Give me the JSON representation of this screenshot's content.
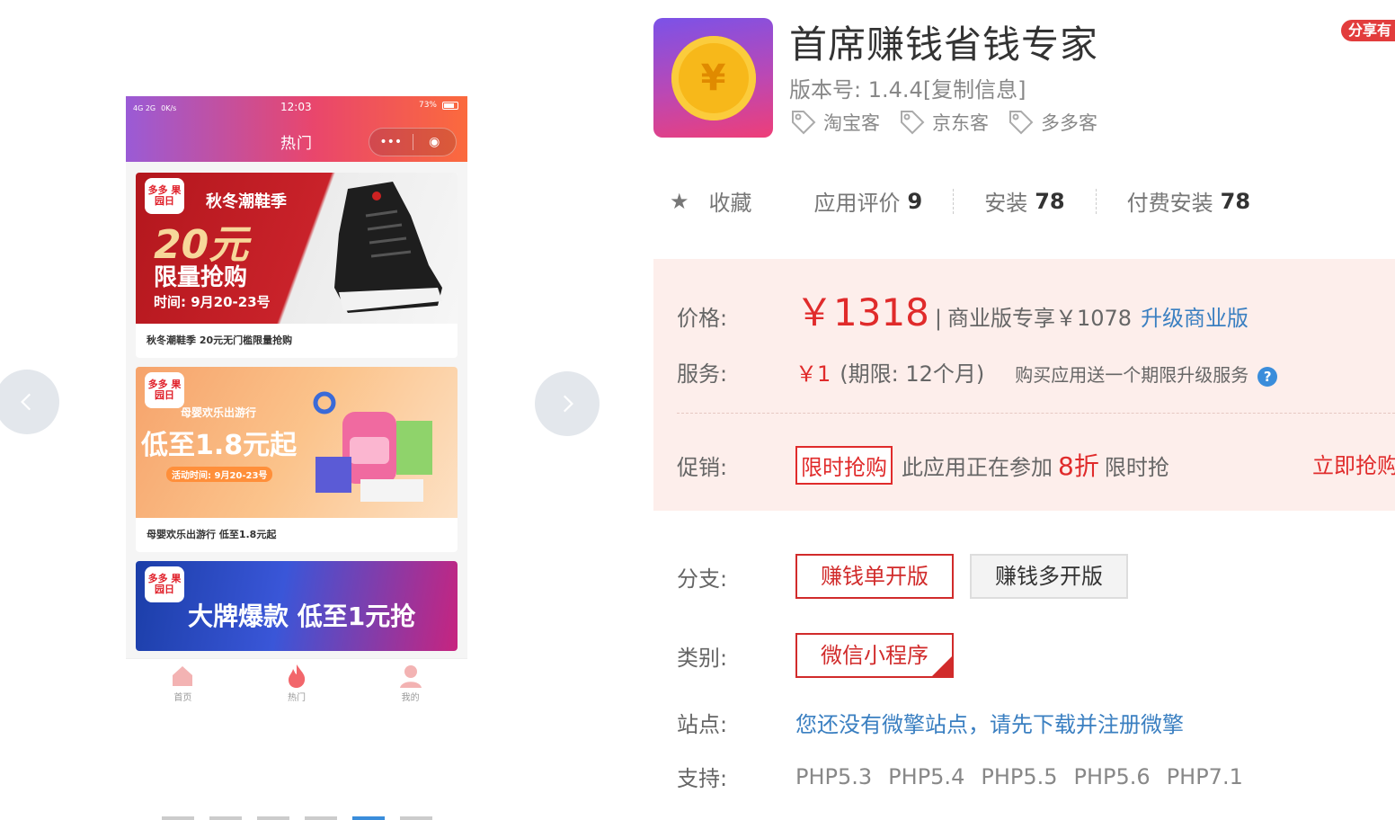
{
  "carousel": {
    "prev_icon": "chevron-left-icon",
    "next_icon": "chevron-right-icon"
  },
  "phone": {
    "status": {
      "signal": "4G 2G",
      "speed": "0K/s",
      "time": "12:03",
      "battery": "73%"
    },
    "title": "热门",
    "capsule_more": "•••",
    "capsule_close": "◉",
    "cards": [
      {
        "logo": "多多 果园日",
        "sub": "秋冬潮鞋季",
        "big": "20元",
        "mid": "限量抢购",
        "time": "时间: 9月20-23号",
        "caption": "秋冬潮鞋季 20元无门槛限量抢购"
      },
      {
        "logo": "多多 果园日",
        "sub": "母婴欢乐出游行",
        "big": "低至1.8元起",
        "time": "活动时间: 9月20-23号",
        "caption": "母婴欢乐出游行 低至1.8元起"
      },
      {
        "logo": "多多 果园日",
        "big": "大牌爆款 低至1元抢"
      }
    ],
    "tabs": [
      {
        "label": "首页",
        "icon": "home-icon"
      },
      {
        "label": "热门",
        "icon": "flame-icon"
      },
      {
        "label": "我的",
        "icon": "user-icon"
      }
    ]
  },
  "app": {
    "title": "首席赚钱省钱专家",
    "share_label": "分享有",
    "version_label": "版本号:",
    "version": "1.4.4",
    "copy_info": "[复制信息]",
    "tags": [
      "淘宝客",
      "京东客",
      "多多客"
    ]
  },
  "stats": {
    "favorite": "收藏",
    "rating_label": "应用评价",
    "rating": "9",
    "install_label": "安装",
    "install": "78",
    "paid_install_label": "付费安装",
    "paid_install": "78"
  },
  "pricing": {
    "price_label": "价格:",
    "price": "￥1318",
    "separator": "|",
    "business_text": "商业版专享￥1078",
    "upgrade_link": "升级商业版",
    "service_label": "服务:",
    "service_price": "￥1",
    "service_period": "(期限: 12个月)",
    "service_note": "购买应用送一个期限升级服务",
    "promo_label": "促销:",
    "flash_tag": "限时抢购",
    "promo_text": "此应用正在参加",
    "discount": "8折",
    "promo_suffix": "限时抢",
    "buy_now": "立即抢购"
  },
  "options": {
    "branch_label": "分支:",
    "branches": [
      "赚钱单开版",
      "赚钱多开版"
    ],
    "category_label": "类别:",
    "category": "微信小程序",
    "site_label": "站点:",
    "site_text": "您还没有微擎站点，请先下载并注册微擎",
    "support_label": "支持:",
    "php_versions": [
      "PHP5.3",
      "PHP5.4",
      "PHP5.5",
      "PHP5.6",
      "PHP7.1"
    ]
  },
  "colors": {
    "accent_red": "#e02b2b",
    "link_blue": "#3a7fc1",
    "panel_bg": "#fdeeeb"
  }
}
